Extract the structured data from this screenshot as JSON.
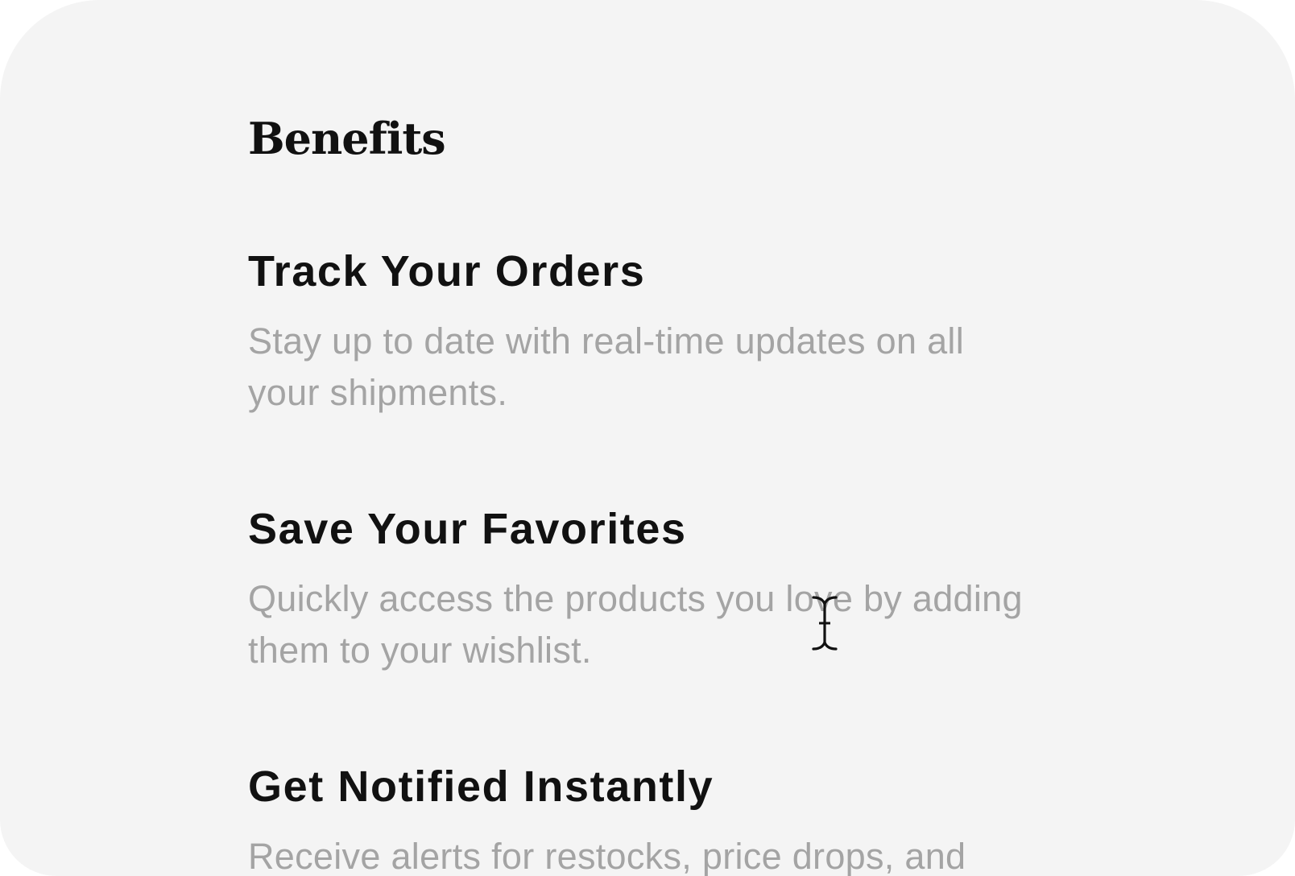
{
  "section": {
    "title": "Benefits"
  },
  "benefits": [
    {
      "title": "Track Your Orders",
      "description": "Stay up to date with real-time updates on all your shipments."
    },
    {
      "title": "Save Your Favorites",
      "description": "Quickly access the products you love by adding them to your wishlist."
    },
    {
      "title": "Get Notified Instantly",
      "description": "Receive alerts for restocks, price drops, and"
    }
  ],
  "cursor": {
    "icon": "text-cursor-icon"
  },
  "colors": {
    "background": "#f4f4f4",
    "heading": "#111111",
    "muted_text": "#a4a4a4"
  }
}
